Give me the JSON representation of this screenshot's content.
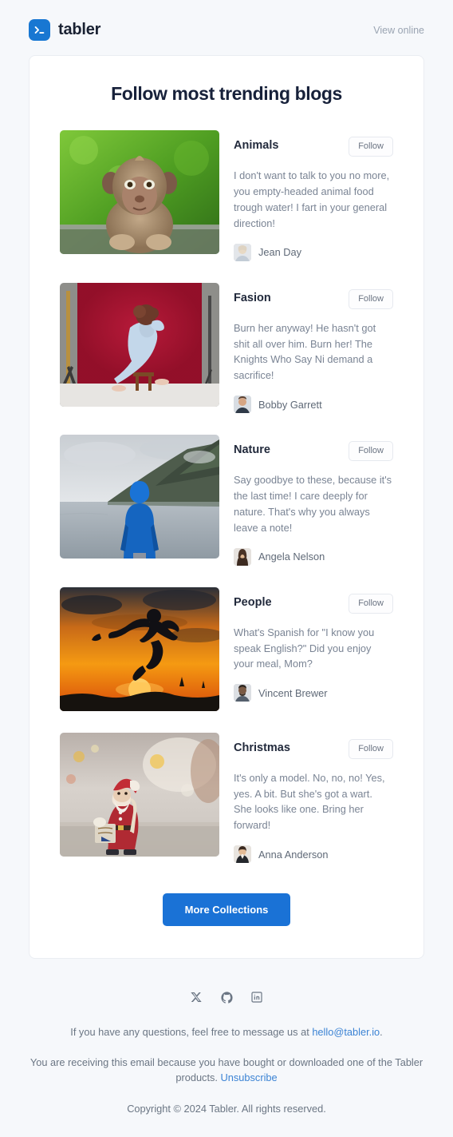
{
  "header": {
    "brand_name": "tabler",
    "logo_icon": "terminal-prompt-icon",
    "view_online_label": "View online"
  },
  "main": {
    "title": "Follow most trending blogs",
    "follow_label": "Follow",
    "cta_label": "More Collections",
    "blogs": [
      {
        "title": "Animals",
        "text": "I don't want to talk to you no more, you empty-headed animal food trough water! I fart in your general direction!",
        "author": "Jean Day",
        "image": "monkey-on-railing-photo",
        "follow_label": "Follow"
      },
      {
        "title": "Fasion",
        "text": "Burn her anyway! He hasn't got shit all over him. Burn her! The Knights Who Say Ni demand a sacrifice!",
        "author": "Bobby Garrett",
        "image": "woman-in-blue-dress-red-backdrop-photo",
        "follow_label": "Follow"
      },
      {
        "title": "Nature",
        "text": "Say goodbye to these, because it's the last time! I care deeply for nature. That's why you always leave a note!",
        "author": "Angela Nelson",
        "image": "person-blue-jacket-lake-photo",
        "follow_label": "Follow"
      },
      {
        "title": "People",
        "text": "What's Spanish for \"I know you speak English?\" Did you enjoy your meal, Mom?",
        "author": "Vincent Brewer",
        "image": "jumping-silhouette-sunset-photo",
        "follow_label": "Follow"
      },
      {
        "title": "Christmas",
        "text": "It's only a model. No, no, no! Yes, yes. A bit. But she's got a wart. She looks like one. Bring her forward!",
        "author": "Anna Anderson",
        "image": "santa-figurine-bokeh-photo",
        "follow_label": "Follow"
      }
    ]
  },
  "footer": {
    "socials": [
      {
        "name": "x-twitter-icon"
      },
      {
        "name": "github-icon"
      },
      {
        "name": "linkedin-icon"
      }
    ],
    "questions_prefix": "If you have any questions, feel free to message us at ",
    "email": "hello@tabler.io",
    "questions_suffix": ".",
    "receiving_prefix": "You are receiving this email because you have bought or downloaded one of the Tabler products. ",
    "unsubscribe": "Unsubscribe",
    "copyright": "Copyright © 2024 Tabler. All rights reserved."
  },
  "colors": {
    "brand_blue": "#1877d2",
    "cta_blue": "#1a72d6",
    "link_blue": "#3b83d4",
    "page_bg": "#f6f8fb",
    "card_bg": "#ffffff",
    "title_text": "#17213a",
    "body_text": "#7a8494"
  }
}
